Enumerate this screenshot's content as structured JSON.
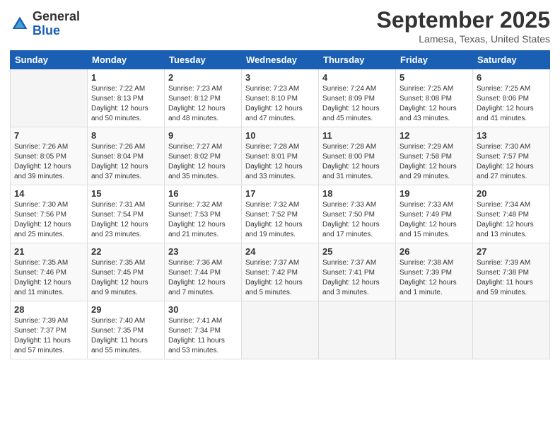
{
  "logo": {
    "line1": "General",
    "line2": "Blue"
  },
  "title": "September 2025",
  "location": "Lamesa, Texas, United States",
  "headers": [
    "Sunday",
    "Monday",
    "Tuesday",
    "Wednesday",
    "Thursday",
    "Friday",
    "Saturday"
  ],
  "weeks": [
    [
      {
        "day": "",
        "info": ""
      },
      {
        "day": "1",
        "info": "Sunrise: 7:22 AM\nSunset: 8:13 PM\nDaylight: 12 hours\nand 50 minutes."
      },
      {
        "day": "2",
        "info": "Sunrise: 7:23 AM\nSunset: 8:12 PM\nDaylight: 12 hours\nand 48 minutes."
      },
      {
        "day": "3",
        "info": "Sunrise: 7:23 AM\nSunset: 8:10 PM\nDaylight: 12 hours\nand 47 minutes."
      },
      {
        "day": "4",
        "info": "Sunrise: 7:24 AM\nSunset: 8:09 PM\nDaylight: 12 hours\nand 45 minutes."
      },
      {
        "day": "5",
        "info": "Sunrise: 7:25 AM\nSunset: 8:08 PM\nDaylight: 12 hours\nand 43 minutes."
      },
      {
        "day": "6",
        "info": "Sunrise: 7:25 AM\nSunset: 8:06 PM\nDaylight: 12 hours\nand 41 minutes."
      }
    ],
    [
      {
        "day": "7",
        "info": "Sunrise: 7:26 AM\nSunset: 8:05 PM\nDaylight: 12 hours\nand 39 minutes."
      },
      {
        "day": "8",
        "info": "Sunrise: 7:26 AM\nSunset: 8:04 PM\nDaylight: 12 hours\nand 37 minutes."
      },
      {
        "day": "9",
        "info": "Sunrise: 7:27 AM\nSunset: 8:02 PM\nDaylight: 12 hours\nand 35 minutes."
      },
      {
        "day": "10",
        "info": "Sunrise: 7:28 AM\nSunset: 8:01 PM\nDaylight: 12 hours\nand 33 minutes."
      },
      {
        "day": "11",
        "info": "Sunrise: 7:28 AM\nSunset: 8:00 PM\nDaylight: 12 hours\nand 31 minutes."
      },
      {
        "day": "12",
        "info": "Sunrise: 7:29 AM\nSunset: 7:58 PM\nDaylight: 12 hours\nand 29 minutes."
      },
      {
        "day": "13",
        "info": "Sunrise: 7:30 AM\nSunset: 7:57 PM\nDaylight: 12 hours\nand 27 minutes."
      }
    ],
    [
      {
        "day": "14",
        "info": "Sunrise: 7:30 AM\nSunset: 7:56 PM\nDaylight: 12 hours\nand 25 minutes."
      },
      {
        "day": "15",
        "info": "Sunrise: 7:31 AM\nSunset: 7:54 PM\nDaylight: 12 hours\nand 23 minutes."
      },
      {
        "day": "16",
        "info": "Sunrise: 7:32 AM\nSunset: 7:53 PM\nDaylight: 12 hours\nand 21 minutes."
      },
      {
        "day": "17",
        "info": "Sunrise: 7:32 AM\nSunset: 7:52 PM\nDaylight: 12 hours\nand 19 minutes."
      },
      {
        "day": "18",
        "info": "Sunrise: 7:33 AM\nSunset: 7:50 PM\nDaylight: 12 hours\nand 17 minutes."
      },
      {
        "day": "19",
        "info": "Sunrise: 7:33 AM\nSunset: 7:49 PM\nDaylight: 12 hours\nand 15 minutes."
      },
      {
        "day": "20",
        "info": "Sunrise: 7:34 AM\nSunset: 7:48 PM\nDaylight: 12 hours\nand 13 minutes."
      }
    ],
    [
      {
        "day": "21",
        "info": "Sunrise: 7:35 AM\nSunset: 7:46 PM\nDaylight: 12 hours\nand 11 minutes."
      },
      {
        "day": "22",
        "info": "Sunrise: 7:35 AM\nSunset: 7:45 PM\nDaylight: 12 hours\nand 9 minutes."
      },
      {
        "day": "23",
        "info": "Sunrise: 7:36 AM\nSunset: 7:44 PM\nDaylight: 12 hours\nand 7 minutes."
      },
      {
        "day": "24",
        "info": "Sunrise: 7:37 AM\nSunset: 7:42 PM\nDaylight: 12 hours\nand 5 minutes."
      },
      {
        "day": "25",
        "info": "Sunrise: 7:37 AM\nSunset: 7:41 PM\nDaylight: 12 hours\nand 3 minutes."
      },
      {
        "day": "26",
        "info": "Sunrise: 7:38 AM\nSunset: 7:39 PM\nDaylight: 12 hours\nand 1 minute."
      },
      {
        "day": "27",
        "info": "Sunrise: 7:39 AM\nSunset: 7:38 PM\nDaylight: 11 hours\nand 59 minutes."
      }
    ],
    [
      {
        "day": "28",
        "info": "Sunrise: 7:39 AM\nSunset: 7:37 PM\nDaylight: 11 hours\nand 57 minutes."
      },
      {
        "day": "29",
        "info": "Sunrise: 7:40 AM\nSunset: 7:35 PM\nDaylight: 11 hours\nand 55 minutes."
      },
      {
        "day": "30",
        "info": "Sunrise: 7:41 AM\nSunset: 7:34 PM\nDaylight: 11 hours\nand 53 minutes."
      },
      {
        "day": "",
        "info": ""
      },
      {
        "day": "",
        "info": ""
      },
      {
        "day": "",
        "info": ""
      },
      {
        "day": "",
        "info": ""
      }
    ]
  ]
}
